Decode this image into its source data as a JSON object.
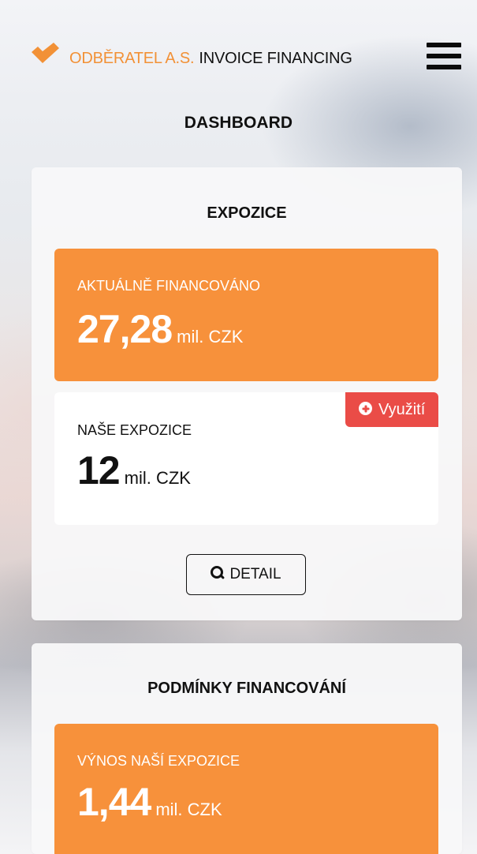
{
  "header": {
    "logo_icon": "checkmark-icon",
    "company": "ODBĚRATEL A.S.",
    "product": "INVOICE FINANCING",
    "menu_icon": "hamburger-menu-icon",
    "accent_color": "#f29136"
  },
  "page": {
    "title": "DASHBOARD"
  },
  "expozice": {
    "title": "EXPOZICE",
    "current_financed": {
      "label": "AKTUÁLNĚ FINANCOVÁNO",
      "value": "27,28",
      "unit": "mil. CZK",
      "background_color": "#f7913b"
    },
    "our_exposure": {
      "label": "NAŠE EXPOZICE",
      "value": "12",
      "unit": "mil. CZK",
      "badge_label": "Využití",
      "badge_icon": "plus-circle-icon",
      "badge_color": "#ea4c47"
    },
    "detail_button": {
      "icon": "search-icon",
      "label": "DETAIL"
    }
  },
  "financing_conditions": {
    "title": "PODMÍNKY FINANCOVÁNÍ",
    "yield": {
      "label": "VÝNOS NAŠÍ EXPOZICE",
      "value": "1,44",
      "unit": "mil. CZK",
      "background_color": "#f7913b"
    }
  }
}
